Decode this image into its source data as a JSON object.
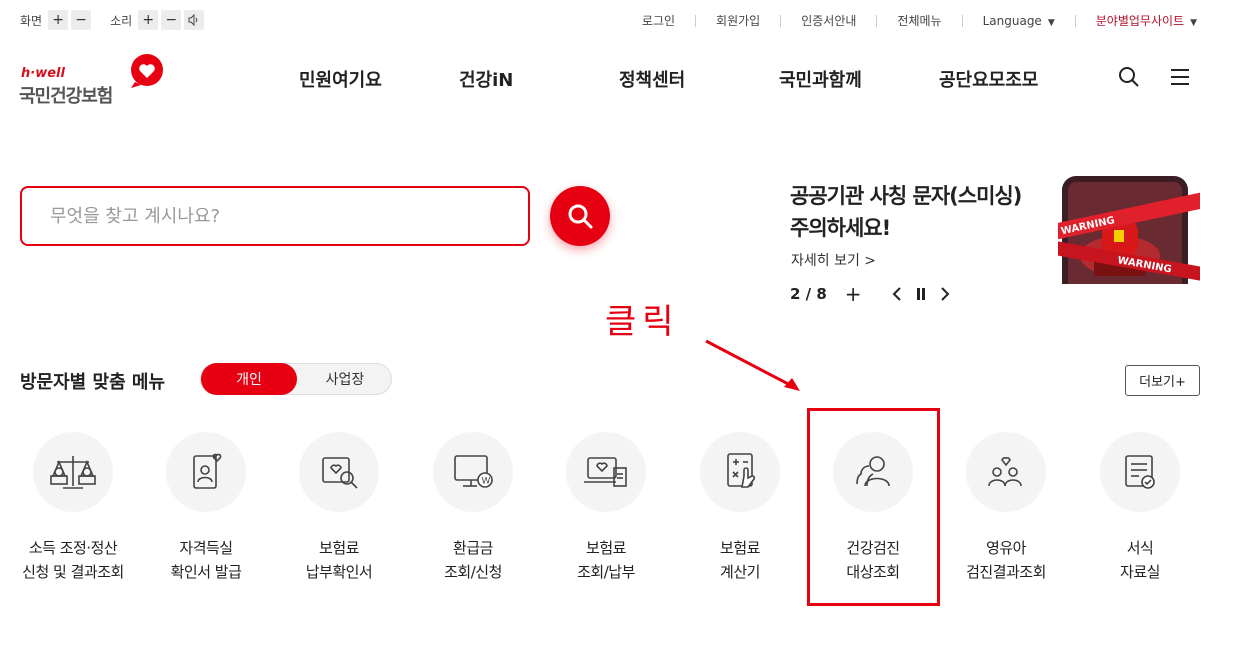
{
  "util": {
    "screen_label": "화면",
    "sound_label": "소리",
    "plus": "+",
    "minus": "−",
    "links": [
      "로그인",
      "회원가입",
      "인증서안내",
      "전체메뉴"
    ],
    "language": "Language",
    "site_select": "분야별업무사이트"
  },
  "logo": {
    "sub": "h·well",
    "name": "국민건강보험"
  },
  "gnb": [
    "민원여기요",
    "건강iN",
    "정책센터",
    "국민과함께",
    "공단요모조모"
  ],
  "search": {
    "placeholder": "무엇을 찾고 계시나요?"
  },
  "banner": {
    "title_line1": "공공기관 사칭 문자(스미싱)",
    "title_line2": "주의하세요!",
    "more": "자세히 보기 >",
    "counter": "2 / 8",
    "plus": "+",
    "image_text_1": "WARNING",
    "image_text_2": "WARNING"
  },
  "annotation": {
    "click": "클릭"
  },
  "visitor_menu": {
    "title": "방문자별 맞춤 메뉴",
    "tab_personal": "개인",
    "tab_business": "사업장",
    "more": "더보기+",
    "items": [
      {
        "line1": "소득 조정·정산",
        "line2": "신청 및 결과조회",
        "icon": "scale-icon"
      },
      {
        "line1": "자격득실",
        "line2": "확인서 발급",
        "icon": "id-card-icon"
      },
      {
        "line1": "보험료",
        "line2": "납부확인서",
        "icon": "payment-search-icon"
      },
      {
        "line1": "환급금",
        "line2": "조회/신청",
        "icon": "monitor-won-icon"
      },
      {
        "line1": "보험료",
        "line2": "조회/납부",
        "icon": "laptop-receipt-icon"
      },
      {
        "line1": "보험료",
        "line2": "계산기",
        "icon": "calculator-icon"
      },
      {
        "line1": "건강검진",
        "line2": "대상조회",
        "icon": "people-icon"
      },
      {
        "line1": "영유아",
        "line2": "검진결과조회",
        "icon": "family-icon"
      },
      {
        "line1": "서식",
        "line2": "자료실",
        "icon": "document-check-icon"
      }
    ]
  },
  "colors": {
    "brand": "#e60012",
    "dark_red": "#b5112a"
  }
}
